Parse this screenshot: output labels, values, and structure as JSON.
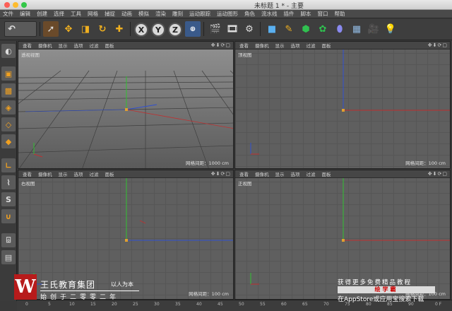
{
  "window": {
    "title": "未标题 1 * - 主要"
  },
  "menubar": [
    "文件",
    "编辑",
    "创建",
    "选择",
    "工具",
    "网格",
    "捕捉",
    "动画",
    "模拟",
    "渲染",
    "雕刻",
    "运动跟踪",
    "运动图形",
    "角色",
    "流水线",
    "插件",
    "脚本",
    "窗口",
    "帮助"
  ],
  "toolbar": {
    "undo_icon": "undo-icon",
    "x_axis": "X",
    "y_axis": "Y",
    "z_axis": "Z",
    "icons": [
      "select-arrow-icon",
      "move-icon",
      "scale-icon",
      "rotate-icon",
      "add-icon",
      "world-coord-icon",
      "render-view-icon",
      "render-picture-icon",
      "render-settings-icon",
      "cube-icon",
      "pen-icon",
      "subdivision-icon",
      "mograph-icon",
      "deformer-icon",
      "floor-icon",
      "camera-icon",
      "light-icon"
    ]
  },
  "viewport_menu": [
    "查看",
    "摄像机",
    "显示",
    "选项",
    "过滤",
    "面板"
  ],
  "viewports": [
    {
      "name": "透视视图",
      "grid": "网格间距：1000 cm"
    },
    {
      "name": "顶视图",
      "grid": "网格间距：100 cm"
    },
    {
      "name": "右视图",
      "grid": "网格间距：100 cm"
    },
    {
      "name": "正视图",
      "grid": "网格间距：100 cm"
    }
  ],
  "timeline": {
    "ticks": [
      "0",
      "5",
      "10",
      "15",
      "20",
      "25",
      "30",
      "35",
      "40",
      "45",
      "50",
      "55",
      "60",
      "65",
      "70",
      "75",
      "80",
      "85",
      "90"
    ],
    "frame": "0 F"
  },
  "watermark": {
    "logo": "W",
    "company": "王氏教育集团",
    "tagline": "以人为本",
    "founded": "始创于二零零二年",
    "promo": "获得更多免费精品教程",
    "banner": "绘学霸",
    "download": "在AppStore或应用宝搜索下载"
  },
  "colors": {
    "x_axis": "#d03030",
    "y_axis": "#30c030",
    "z_axis": "#3050d0",
    "accent": "#f0a020"
  }
}
